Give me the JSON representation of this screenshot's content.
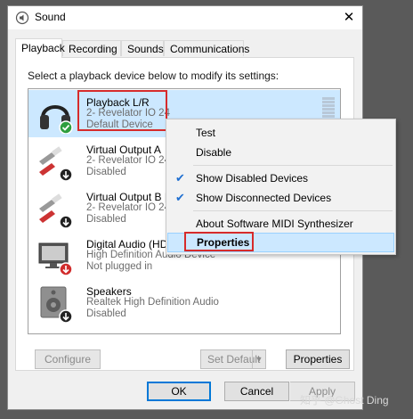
{
  "window": {
    "title": "Sound",
    "close_symbol": "✕"
  },
  "tabs": [
    {
      "label": "Playback",
      "active": true
    },
    {
      "label": "Recording"
    },
    {
      "label": "Sounds"
    },
    {
      "label": "Communications"
    }
  ],
  "instruction": "Select a playback device below to modify its settings:",
  "devices": [
    {
      "name": "Playback L/R",
      "sub": "2- Revelator IO 24",
      "status": "Default Device",
      "icon": "headphones-icon",
      "badge": "check-badge-icon"
    },
    {
      "name": "Virtual Output A",
      "sub": "2- Revelator IO 24",
      "status": "Disabled",
      "icon": "rca-cable-icon",
      "badge": "down-arrow-badge-icon"
    },
    {
      "name": "Virtual Output B |",
      "sub": "2- Revelator IO 24",
      "status": "Disabled",
      "icon": "rca-cable-icon",
      "badge": "down-arrow-badge-icon"
    },
    {
      "name": "Digital Audio (HD",
      "sub": "High Definition Audio Device",
      "status": "Not plugged in",
      "icon": "monitor-icon",
      "badge": "down-arrow-red-badge-icon"
    },
    {
      "name": "Speakers",
      "sub": "Realtek High Definition Audio",
      "status": "Disabled",
      "icon": "speaker-icon",
      "badge": "down-arrow-badge-icon"
    }
  ],
  "buttons": {
    "configure": "Configure",
    "set_default": "Set Default",
    "properties": "Properties",
    "ok": "OK",
    "cancel": "Cancel",
    "apply": "Apply"
  },
  "context_menu": {
    "test": "Test",
    "disable": "Disable",
    "show_disabled": "Show Disabled Devices",
    "show_disconnected": "Show Disconnected Devices",
    "about_midi": "About Software MIDI Synthesizer",
    "properties": "Properties",
    "check_symbol": "✔"
  },
  "watermark": "知乎 @Ghost Ding",
  "colors": {
    "selection": "#cce8ff",
    "highlight_box": "#d62b2b",
    "check": "#1f6fd1"
  }
}
